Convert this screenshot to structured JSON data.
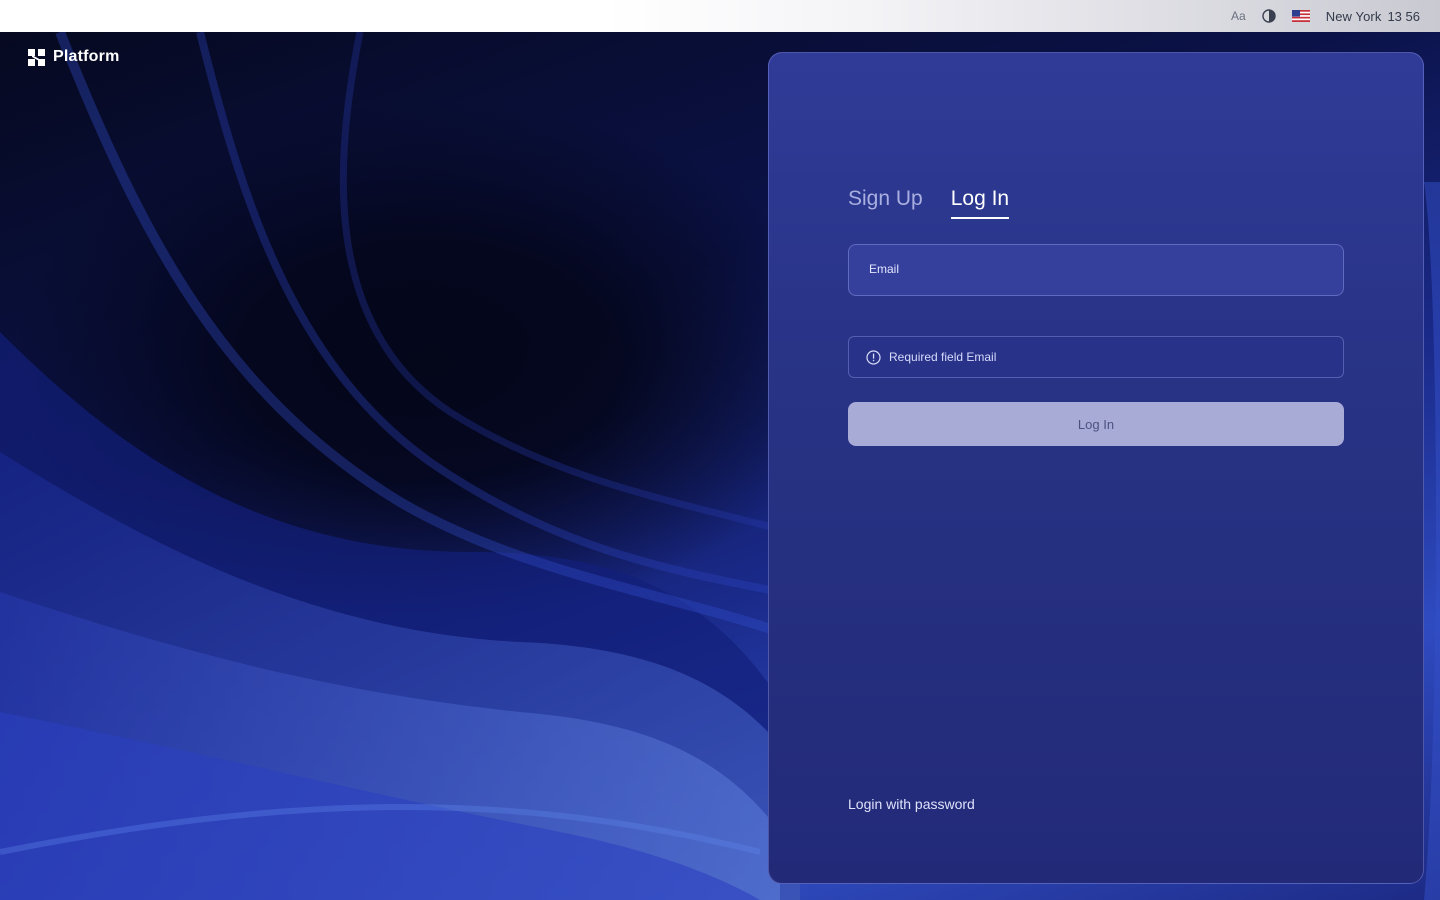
{
  "topbar": {
    "font_label": "Aa",
    "contrast_icon": "contrast-icon",
    "flag_icon": "us-flag-icon",
    "city": "New York",
    "time": "13 56"
  },
  "brand": {
    "name": "Platform",
    "icon": "platform-logo-icon"
  },
  "auth": {
    "tabs": [
      {
        "label": "Sign Up",
        "active": false
      },
      {
        "label": "Log In",
        "active": true
      }
    ],
    "email_label": "Email",
    "email_value": "",
    "error_icon": "info-icon",
    "error_text": "Required field Email",
    "submit_label": "Log In",
    "alt_login_label": "Login with password"
  },
  "colors": {
    "card_bg": "#2a3488",
    "button_disabled_bg": "#a8abd6",
    "accent_white": "#ffffff"
  }
}
